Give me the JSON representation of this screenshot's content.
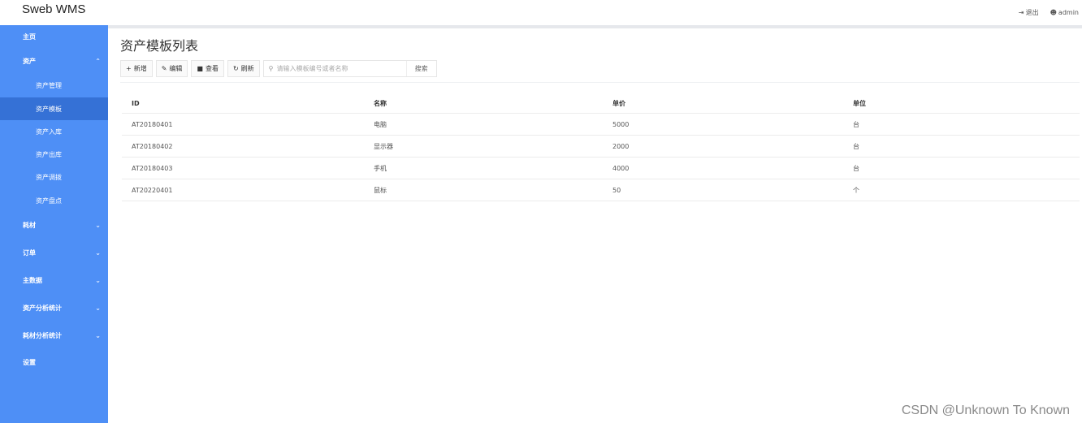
{
  "app": {
    "title": "Sweb WMS"
  },
  "header": {
    "actions": [
      {
        "label": "退出",
        "icon": "logout-icon"
      },
      {
        "label": "admin",
        "icon": "user-icon"
      }
    ]
  },
  "sidebar": {
    "items": [
      {
        "label": "主页",
        "expandable": false
      },
      {
        "label": "资产",
        "expandable": true,
        "expanded": true
      },
      {
        "label": "资产管理",
        "sub": true
      },
      {
        "label": "资产模板",
        "sub": true,
        "active": true
      },
      {
        "label": "资产入库",
        "sub": true
      },
      {
        "label": "资产出库",
        "sub": true
      },
      {
        "label": "资产调拨",
        "sub": true
      },
      {
        "label": "资产盘点",
        "sub": true
      },
      {
        "label": "耗材",
        "expandable": true
      },
      {
        "label": "订单",
        "expandable": true
      },
      {
        "label": "主数据",
        "expandable": true
      },
      {
        "label": "资产分析统计",
        "expandable": true
      },
      {
        "label": "耗材分析统计",
        "expandable": true
      },
      {
        "label": "设置",
        "expandable": false
      }
    ]
  },
  "main": {
    "title": "资产模板列表",
    "toolbar": {
      "add_label": "新增",
      "edit_label": "编辑",
      "view_label": "查看",
      "refresh_label": "刷新",
      "search_placeholder": "请输入模板编号或者名称",
      "search_label": "搜索"
    },
    "table": {
      "columns": [
        "ID",
        "名称",
        "单价",
        "单位"
      ],
      "rows": [
        [
          "AT20180401",
          "电脑",
          "5000",
          "台"
        ],
        [
          "AT20180402",
          "显示器",
          "2000",
          "台"
        ],
        [
          "AT20180403",
          "手机",
          "4000",
          "台"
        ],
        [
          "AT20220401",
          "鼠标",
          "50",
          "个"
        ]
      ]
    }
  },
  "watermark": "CSDN @Unknown To Known",
  "colors": {
    "sidebar": "#4e8ff6",
    "sidebar_active": "#3571d6"
  }
}
